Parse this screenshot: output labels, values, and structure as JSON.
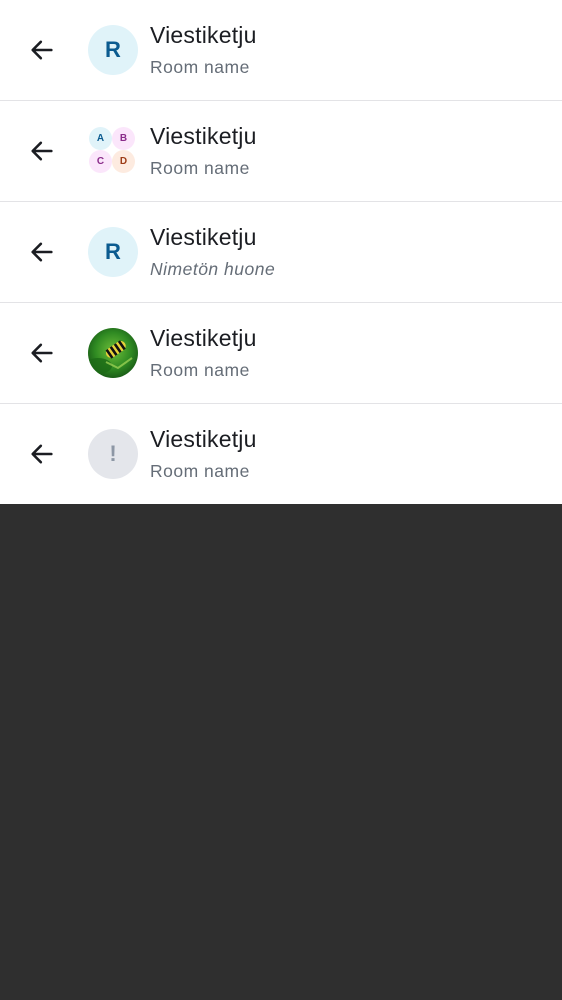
{
  "rows": [
    {
      "title": "Viestiketju",
      "subtitle": "Room name",
      "avatar_letter": "R"
    },
    {
      "title": "Viestiketju",
      "subtitle": "Room name",
      "avatar_letters": [
        "A",
        "B",
        "C",
        "D"
      ]
    },
    {
      "title": "Viestiketju",
      "subtitle": "Nimetön huone",
      "avatar_letter": "R"
    },
    {
      "title": "Viestiketju",
      "subtitle": "Room name"
    },
    {
      "title": "Viestiketju",
      "subtitle": "Room name",
      "avatar_letter": "!"
    }
  ],
  "icons": {
    "back": "arrow-left-icon",
    "photo": "caterpillar-photo"
  },
  "colors": {
    "background": "#2f2f2f",
    "surface": "#ffffff",
    "title": "#1b1d22",
    "subtitle": "#656d77",
    "avatar_bg": "#e0f3f9",
    "avatar_fg": "#0b5b90"
  }
}
